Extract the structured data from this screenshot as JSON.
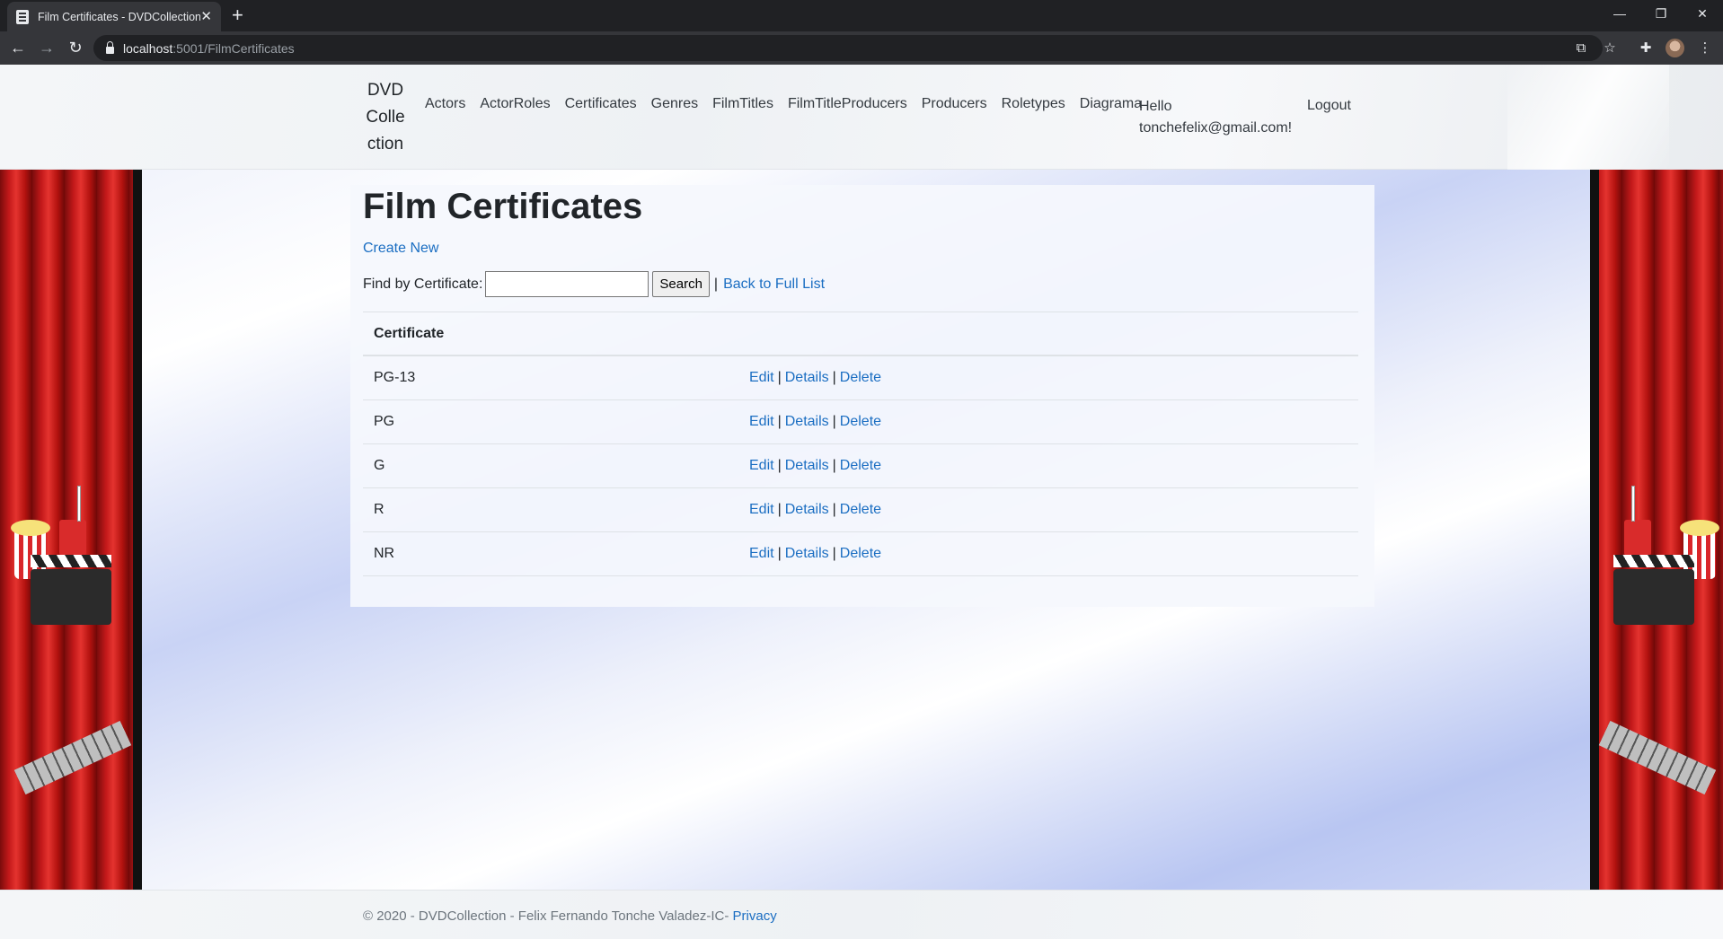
{
  "browser": {
    "tab_title": "Film Certificates - DVDCollection",
    "url_host": "localhost",
    "url_path": ":5001/FilmCertificates"
  },
  "site": {
    "brand": "DVD Collection",
    "nav": [
      "Actors",
      "ActorRoles",
      "Certificates",
      "Genres",
      "FilmTitles",
      "FilmTitleProducers",
      "Producers",
      "Roletypes",
      "Diagrama"
    ],
    "hello_line1": "Hello",
    "hello_line2": "tonchefelix@gmail.com!",
    "logout": "Logout"
  },
  "main": {
    "title": "Film Certificates",
    "create_new": "Create New",
    "find_label": "Find by Certificate:",
    "search_value": "",
    "search_button": "Search",
    "separator": "|",
    "back_link": "Back to Full List",
    "column_header": "Certificate",
    "rows": [
      {
        "certificate": "PG-13"
      },
      {
        "certificate": "PG"
      },
      {
        "certificate": "G"
      },
      {
        "certificate": "R"
      },
      {
        "certificate": "NR"
      }
    ],
    "actions": {
      "edit": "Edit",
      "details": "Details",
      "delete": "Delete",
      "sep": "|"
    }
  },
  "footer": {
    "text": "© 2020 - DVDCollection - Felix Fernando Tonche Valadez-IC-",
    "privacy": "Privacy"
  },
  "colors": {
    "link": "#1b6ec2",
    "chrome_dark": "#202124",
    "curtain": "#c3191a"
  }
}
